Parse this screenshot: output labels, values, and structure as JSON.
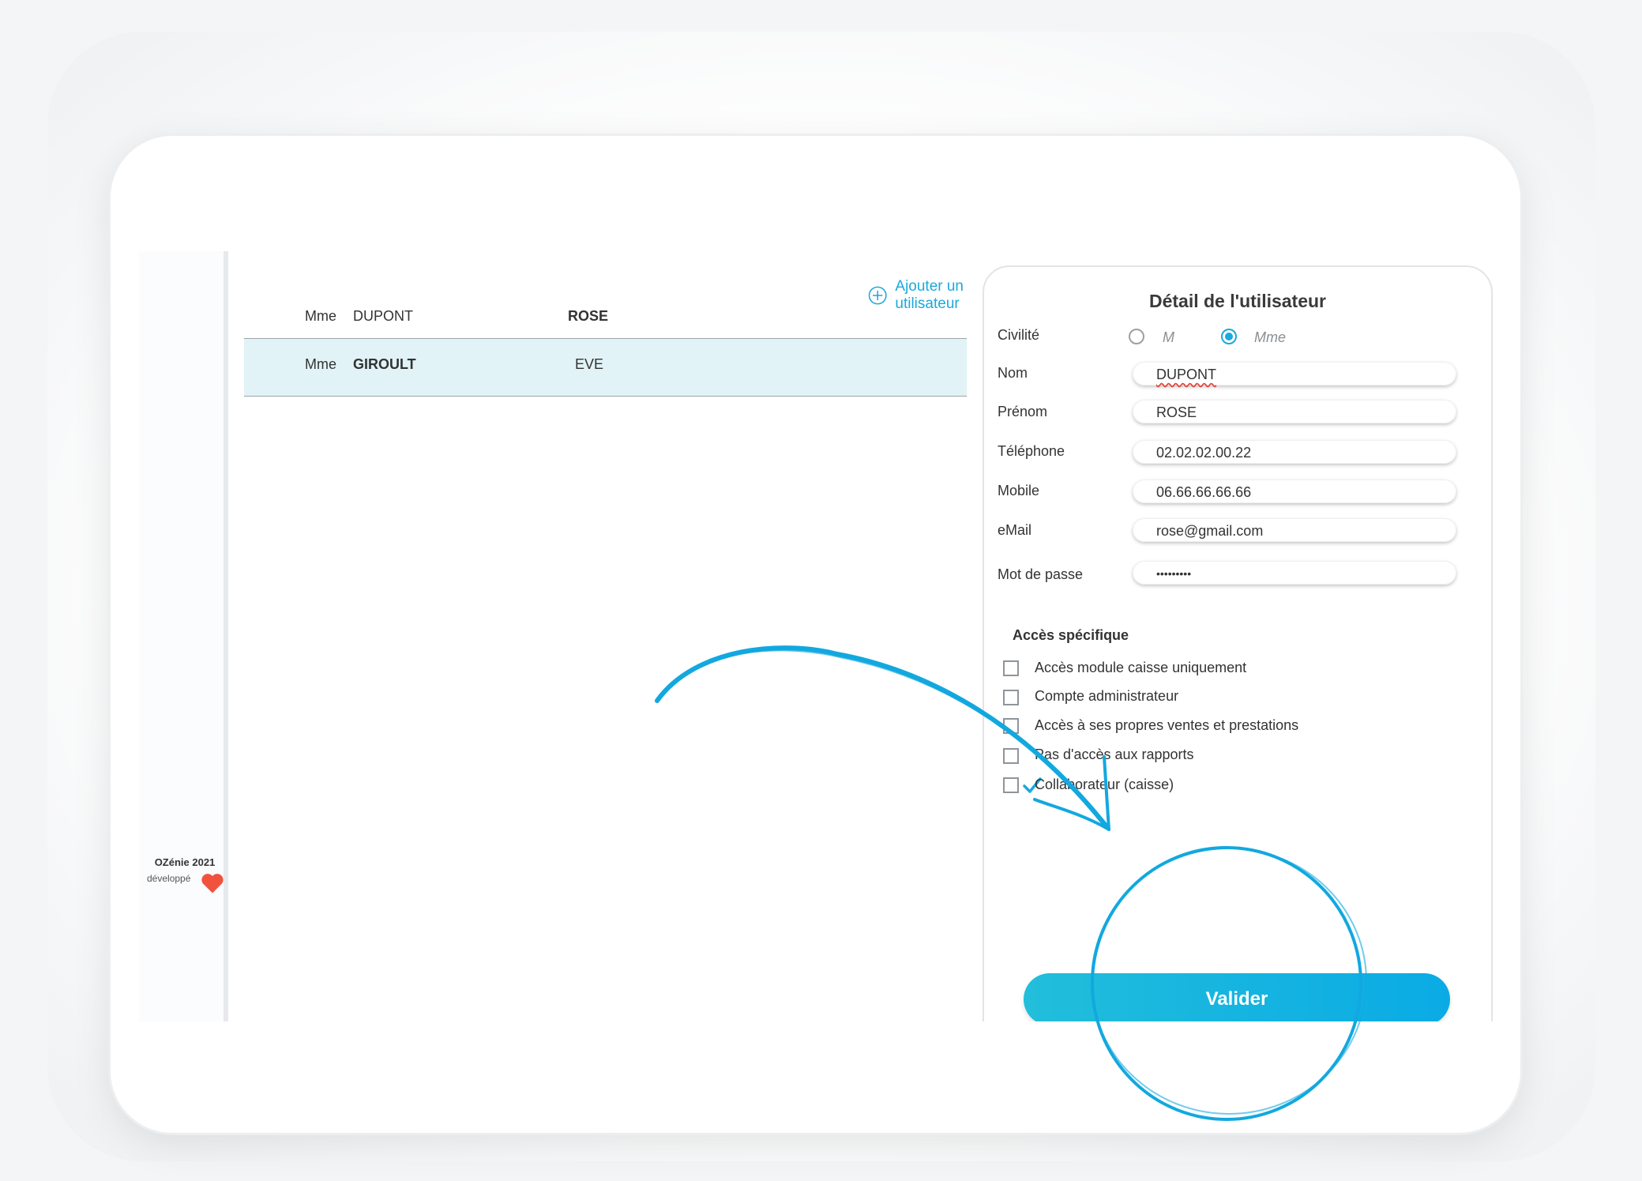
{
  "list": {
    "add_user_label": "Ajouter un utilisateur",
    "users": [
      {
        "civilite": "Mme",
        "nom": "DUPONT",
        "prenom": "ROSE"
      },
      {
        "civilite": "Mme",
        "nom": "GIROULT",
        "prenom": "EVE"
      }
    ]
  },
  "panel": {
    "title": "Détail de l'utilisateur",
    "civilite_label": "Civilité",
    "civilite_options": [
      "M",
      "Mme"
    ],
    "civilite_selected": "Mme",
    "fields": {
      "nom": {
        "label": "Nom",
        "value": "DUPONT"
      },
      "prenom": {
        "label": "Prénom",
        "value": "ROSE"
      },
      "telephone": {
        "label": "Téléphone",
        "value": "02.02.02.00.22"
      },
      "mobile": {
        "label": "Mobile",
        "value": "06.66.66.66.66"
      },
      "email": {
        "label": "eMail",
        "value": "rose@gmail.com"
      },
      "password": {
        "label": "Mot de passe",
        "value": "•••••••••"
      }
    },
    "access_title": "Accès spécifique",
    "access_options": [
      {
        "label": "Accès module caisse uniquement",
        "checked": false
      },
      {
        "label": "Compte administrateur",
        "checked": false
      },
      {
        "label": "Accès à ses propres ventes et prestations",
        "checked": false
      },
      {
        "label": "Pas d'accès aux rapports",
        "checked": false
      },
      {
        "label": "Collaborateur (caisse)",
        "checked": true
      }
    ],
    "submit_label": "Valider"
  },
  "footer": {
    "brand": "OZénie 2021",
    "developed": "développé"
  },
  "colors": {
    "accent": "#1aa9dc",
    "selected_row": "#e1f3f6",
    "heart": "#f0523e"
  }
}
